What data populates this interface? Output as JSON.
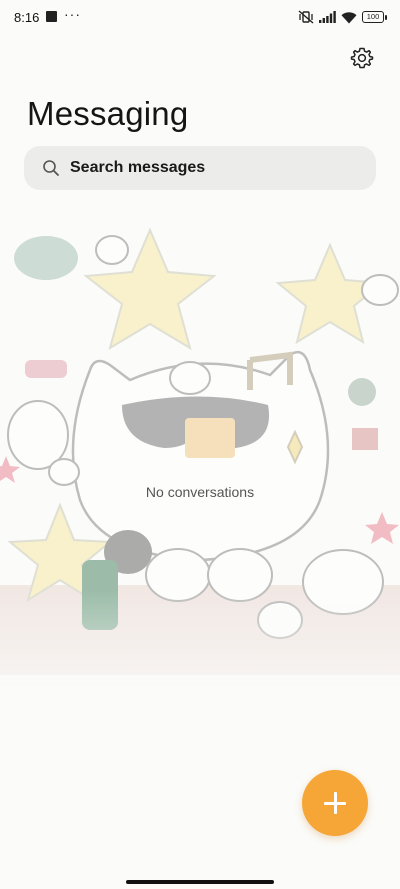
{
  "status_bar": {
    "time": "8:16",
    "more_indicator": "···",
    "battery": "100",
    "icons": [
      "stop-icon",
      "vibrate-off-icon",
      "cellular-signal-icon",
      "wifi-icon",
      "battery-icon"
    ]
  },
  "header": {
    "title": "Messaging",
    "settings_icon": "gear-icon"
  },
  "search": {
    "placeholder": "Search messages",
    "icon": "search-icon"
  },
  "empty_state": {
    "message": "No conversations"
  },
  "fab": {
    "icon": "plus-icon",
    "color": "#f6a537"
  },
  "colors": {
    "accent": "#f6a537",
    "search_bg": "#ececeb"
  }
}
